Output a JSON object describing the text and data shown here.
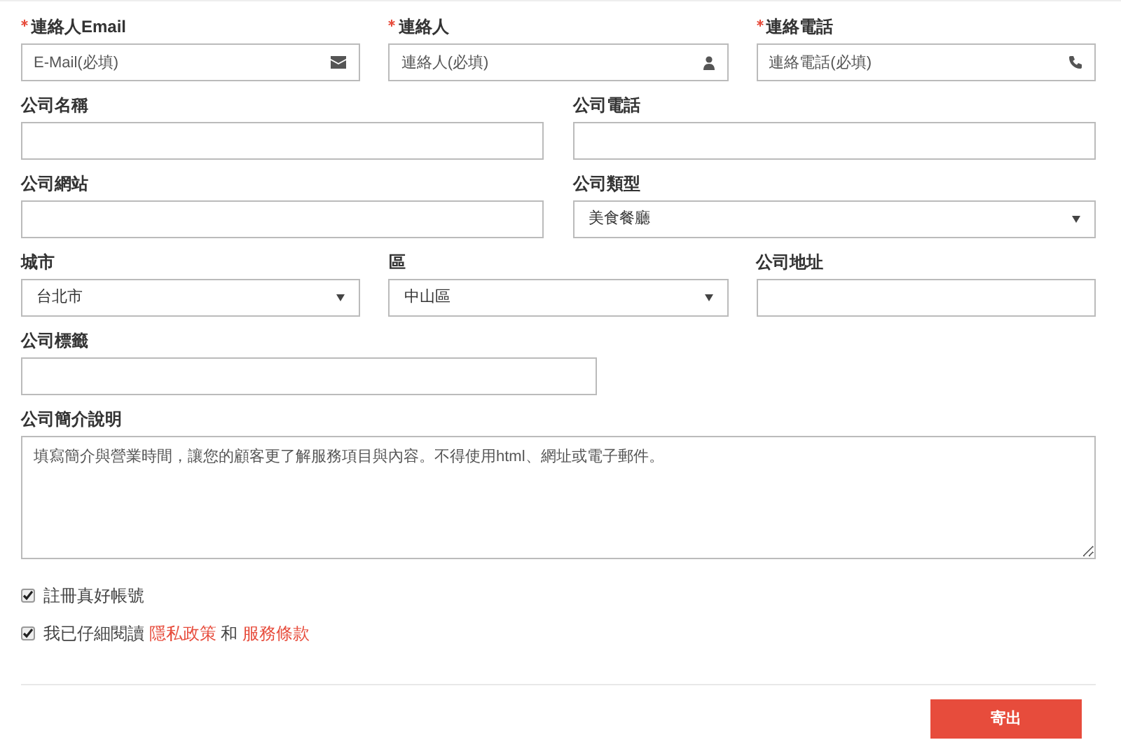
{
  "rows": [
    {
      "fields": [
        {
          "kind": "email",
          "label": "連絡人Email",
          "required": true,
          "placeholder": "E-Mail(必填)"
        },
        {
          "kind": "person",
          "label": "連絡人",
          "required": true,
          "placeholder": "連絡人(必填)"
        },
        {
          "kind": "phone",
          "label": "連絡電話",
          "required": true,
          "placeholder": "連絡電話(必填)"
        }
      ]
    },
    {
      "fields": [
        {
          "kind": "text",
          "label": "公司名稱",
          "required": false
        },
        {
          "kind": "text",
          "label": "公司電話",
          "required": false
        }
      ]
    },
    {
      "fields": [
        {
          "kind": "text",
          "label": "公司網站",
          "required": false
        },
        {
          "kind": "select",
          "label": "公司類型",
          "required": false,
          "value": "美食餐廳"
        }
      ]
    },
    {
      "fields": [
        {
          "kind": "select",
          "label": "城市",
          "required": false,
          "value": "台北市"
        },
        {
          "kind": "select",
          "label": "區",
          "required": false,
          "value": "中山區"
        },
        {
          "kind": "text",
          "label": "公司地址",
          "required": false
        }
      ]
    },
    {
      "fields": [
        {
          "kind": "text",
          "label": "公司標籤",
          "required": false
        }
      ]
    },
    {
      "fields": [
        {
          "kind": "textarea",
          "label": "公司簡介說明",
          "required": false,
          "placeholder": "填寫簡介與營業時間，讓您的顧客更了解服務項目與內容。不得使用html、網址或電子郵件。"
        }
      ]
    }
  ],
  "checkboxes": [
    {
      "checked": true,
      "segments": [
        {
          "kind": "text",
          "text": "註冊真好帳號"
        }
      ]
    },
    {
      "checked": true,
      "segments": [
        {
          "kind": "text",
          "text": "我已仔細閱讀"
        },
        {
          "kind": "link",
          "text": "隱私政策"
        },
        {
          "kind": "text",
          "text": "和"
        },
        {
          "kind": "link",
          "text": "服務條款"
        }
      ]
    }
  ],
  "submit": {
    "label": "寄出"
  }
}
